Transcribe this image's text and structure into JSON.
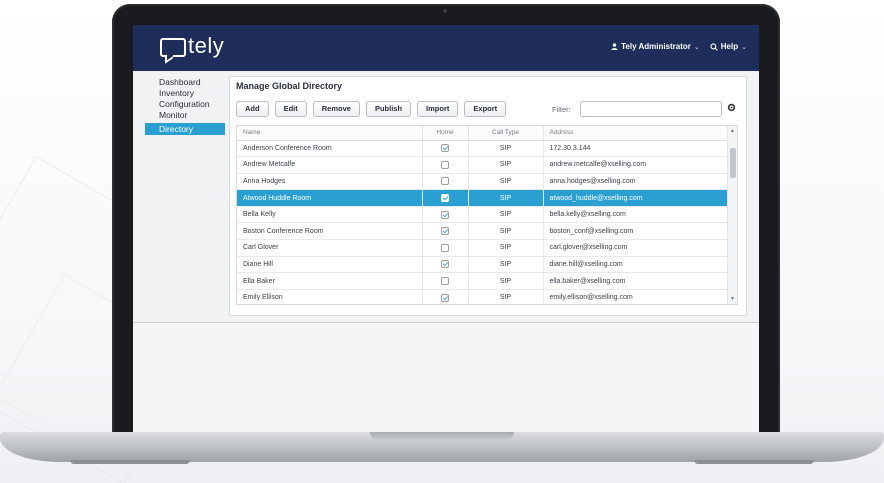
{
  "app": {
    "logo_text": "tely",
    "user_menu": "Tely Administrator",
    "help_menu": "Help"
  },
  "sidebar": {
    "items": [
      {
        "label": "Dashboard"
      },
      {
        "label": "Inventory"
      },
      {
        "label": "Configuration"
      },
      {
        "label": "Monitor"
      },
      {
        "label": "Directory"
      }
    ],
    "active": "Directory"
  },
  "main": {
    "title": "Manage Global Directory",
    "buttons": {
      "add": "Add",
      "edit": "Edit",
      "remove": "Remove",
      "publish": "Publish",
      "import": "Import",
      "export": "Export"
    },
    "filter_label": "Filter:",
    "filter_value": ""
  },
  "table": {
    "headers": {
      "name": "Name",
      "home": "Home",
      "call_type": "Call Type",
      "address": "Address"
    },
    "rows": [
      {
        "name": "Anderson Conference Room",
        "home": true,
        "call_type": "SIP",
        "address": "172.30.3.144"
      },
      {
        "name": "Andrew Metcalfe",
        "home": false,
        "call_type": "SIP",
        "address": "andrew.metcalfe@xselling.com"
      },
      {
        "name": "Anna Hodges",
        "home": false,
        "call_type": "SIP",
        "address": "anna.hodges@xselling.com"
      },
      {
        "name": "Atwood Huddle Room",
        "home": true,
        "call_type": "SIP",
        "address": "atwood_huddle@xselling.com",
        "selected": true
      },
      {
        "name": "Bella Kelly",
        "home": true,
        "call_type": "SIP",
        "address": "bella.kelly@xselling.com"
      },
      {
        "name": "Boston Conference Room",
        "home": true,
        "call_type": "SIP",
        "address": "boston_conf@xselling.com"
      },
      {
        "name": "Carl Glover",
        "home": false,
        "call_type": "SIP",
        "address": "carl.glover@xselling.com"
      },
      {
        "name": "Diane Hill",
        "home": true,
        "call_type": "SIP",
        "address": "diane.hill@xselling.com"
      },
      {
        "name": "Ella Baker",
        "home": false,
        "call_type": "SIP",
        "address": "ella.baker@xselling.com"
      },
      {
        "name": "Emily Ellison",
        "home": true,
        "call_type": "SIP",
        "address": "emily.ellison@xselling.com"
      }
    ]
  },
  "colors": {
    "header_bg": "#1e2d59",
    "accent": "#2a9fd1"
  },
  "icons": {
    "user": "user-icon",
    "help": "help-icon",
    "settings": "gear-icon"
  }
}
